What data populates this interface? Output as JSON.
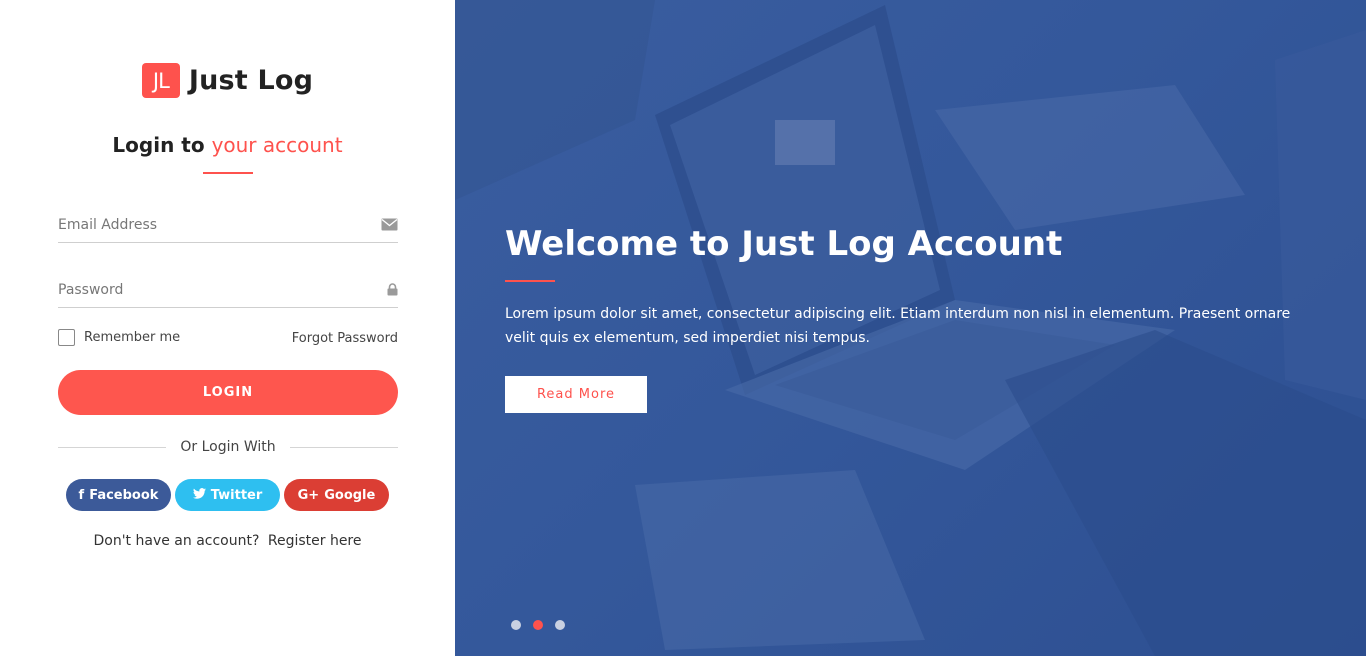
{
  "brand": {
    "mark": "JL",
    "name": "Just Log"
  },
  "login": {
    "title_main": "Login to",
    "title_accent": "your account",
    "email_placeholder": "Email Address",
    "password_placeholder": "Password",
    "remember_label": "Remember me",
    "forgot_label": "Forgot Password",
    "submit_label": "LOGIN",
    "divider_text": "Or Login With",
    "register_prompt": "Don't have an account?",
    "register_link": "Register here"
  },
  "socials": [
    {
      "label": "Facebook",
      "icon": "facebook-icon",
      "glyph": "f",
      "color": "#3c5a99"
    },
    {
      "label": "Twitter",
      "icon": "twitter-icon",
      "glyph": "🐦",
      "color": "#2ebff0"
    },
    {
      "label": "Google",
      "icon": "google-plus-icon",
      "glyph": "G+",
      "color": "#db3e34"
    }
  ],
  "hero": {
    "title": "Welcome to Just Log Account",
    "text": "Lorem ipsum dolor sit amet, consectetur adipiscing elit. Etiam interdum non nisl in elementum. Praesent ornare velit quis ex elementum, sed imperdiet nisi tempus.",
    "button_label": "Read More",
    "slides_count": 3,
    "active_slide": 2
  },
  "colors": {
    "accent": "#fe524d",
    "hero_bg": "#34589b"
  }
}
